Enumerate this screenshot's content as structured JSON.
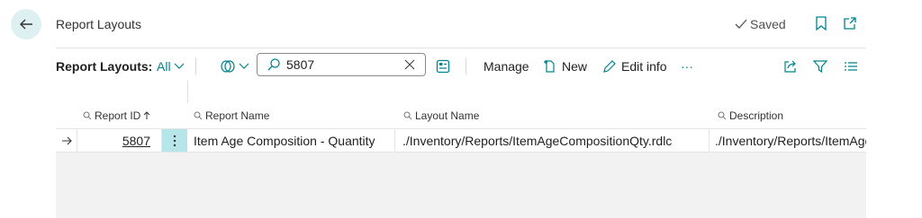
{
  "header": {
    "title": "Report Layouts",
    "saved_label": "Saved"
  },
  "actionbar": {
    "page_label": "Report Layouts:",
    "view_label": "All",
    "manage_label": "Manage",
    "new_label": "New",
    "edit_info_label": "Edit info",
    "more_label": "···"
  },
  "search": {
    "value": "5807"
  },
  "table": {
    "columns": {
      "report_id": "Report ID",
      "report_name": "Report Name",
      "layout_name": "Layout Name",
      "description": "Description"
    },
    "rows": [
      {
        "report_id": "5807",
        "report_name": "Item Age Composition - Quantity",
        "layout_name": "./Inventory/Reports/ItemAgeCompositionQty.rdlc",
        "description": "./Inventory/Reports/ItemAge"
      }
    ]
  },
  "colors": {
    "accent": "#00838f",
    "back_button_bg": "#dff0f2",
    "selected_cell_bg": "#b6e6ea"
  }
}
